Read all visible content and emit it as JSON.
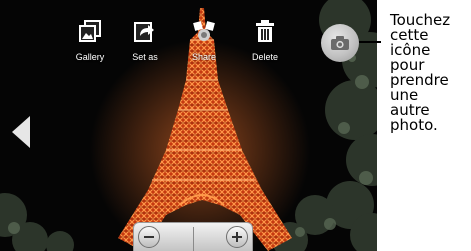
{
  "toolbar": {
    "items": [
      {
        "label": "Gallery",
        "icon": "gallery-icon"
      },
      {
        "label": "Set as",
        "icon": "set-as-icon"
      },
      {
        "label": "Share",
        "icon": "share-icon"
      },
      {
        "label": "Delete",
        "icon": "trash-icon"
      }
    ]
  },
  "camera_button": {
    "icon": "camera-icon"
  },
  "nav": {
    "previous_icon": "chevron-left-icon"
  },
  "zoom": {
    "out_icon": "zoom-out-icon",
    "in_icon": "zoom-in-icon"
  },
  "photo": {
    "subject": "illuminated-tower-at-night"
  },
  "callout": {
    "lines": [
      "Touchez",
      "cette",
      "icône",
      "pour",
      "prendre",
      "une",
      "autre",
      "photo."
    ]
  },
  "colors": {
    "background": "#050505",
    "tower": "#e8501c",
    "tower_glow": "#ff8a3a",
    "foliage": "#3d4a3a",
    "text": "#ffffff",
    "callout_text": "#000000"
  }
}
